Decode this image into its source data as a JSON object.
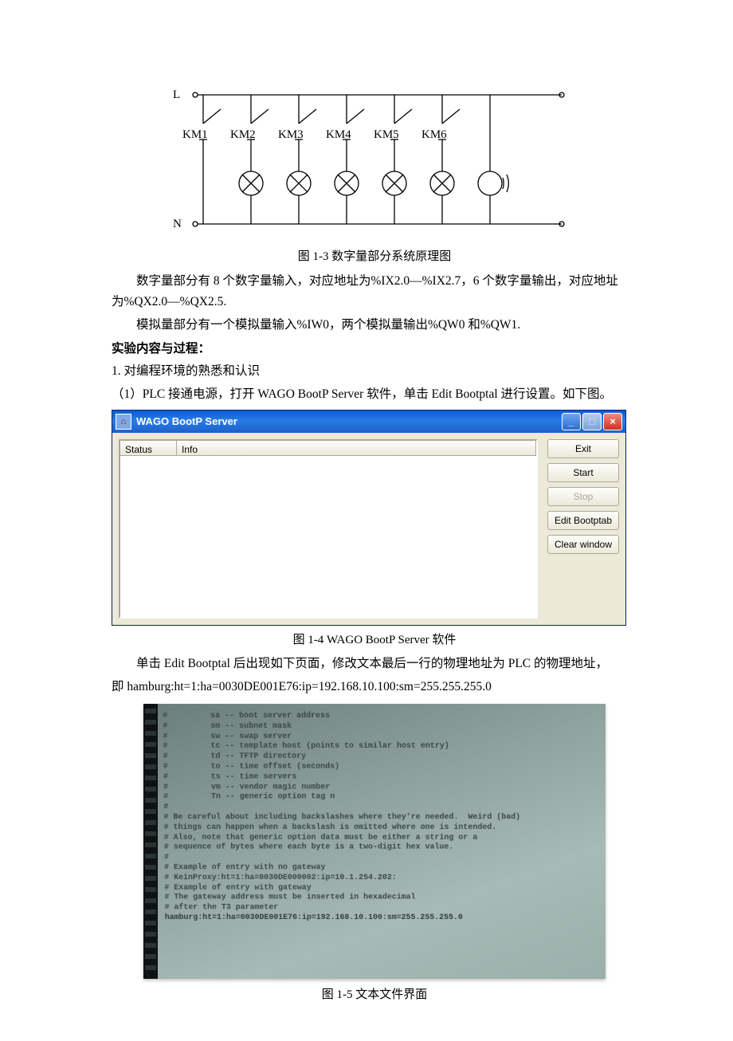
{
  "diagram": {
    "labels": {
      "L": "L",
      "N": "N"
    },
    "contacts": [
      "KM1",
      "KM2",
      "KM3",
      "KM4",
      "KM5",
      "KM6"
    ]
  },
  "captions": {
    "fig13": "图 1-3    数字量部分系统原理图",
    "fig14": "图 1-4    WAGO BootP Server 软件",
    "fig15": "图 1-5    文本文件界面"
  },
  "text": {
    "p1": "数字量部分有 8 个数字量输入，对应地址为%IX2.0—%IX2.7，6 个数字量输出，对应地址为%QX2.0—%QX2.5.",
    "p2": "模拟量部分有一个模拟量输入%IW0，两个模拟量输出%QW0 和%QW1.",
    "section": "实验内容与过程：",
    "step1": "1. 对编程环境的熟悉和认识",
    "step1a": "（1）PLC 接通电源，打开 WAGO BootP Server 软件，单击 Edit Bootptal 进行设置。如下图。",
    "p3a": "单击 Edit Bootptal 后出现如下页面，修改文本最后一行的物理地址为 PLC 的物理地址，",
    "p3b": "即 hamburg:ht=1:ha=0030DE001E76:ip=192.168.10.100:sm=255.255.255.0"
  },
  "bootp": {
    "title": "WAGO BootP Server",
    "columns": {
      "status": "Status",
      "info": "Info"
    },
    "buttons": {
      "exit": "Exit",
      "start": "Start",
      "stop": "Stop",
      "edit": "Edit Bootptab",
      "clear": "Clear window"
    }
  },
  "bootptab": {
    "legend": [
      "sa -- boot server address",
      "sm -- subnet mask",
      "sw -- swap server",
      "tc -- template host (points to similar host entry)",
      "td -- TFTP directory",
      "to -- time offset (seconds)",
      "ts -- time servers",
      "vm -- vendor magic number",
      "Tn -- generic option tag n"
    ],
    "warn": [
      "Be careful about including backslashes where they're needed.  Weird (bad)",
      "things can happen when a backslash is omitted where one is intended.",
      "Also, note that generic option data must be either a string or a",
      "sequence of bytes where each byte is a two-digit hex value."
    ],
    "examples": [
      "Example of entry with no gateway",
      "KeinProxy:ht=1:ha=0030DE000002:ip=10.1.254.202:",
      "Example of entry with gateway",
      "The gateway address must be inserted in hexadecimal",
      "after the T3 parameter"
    ],
    "lastline": "hamburg:ht=1:ha=0030DE001E76:ip=192.168.10.100:sm=255.255.255.0"
  }
}
